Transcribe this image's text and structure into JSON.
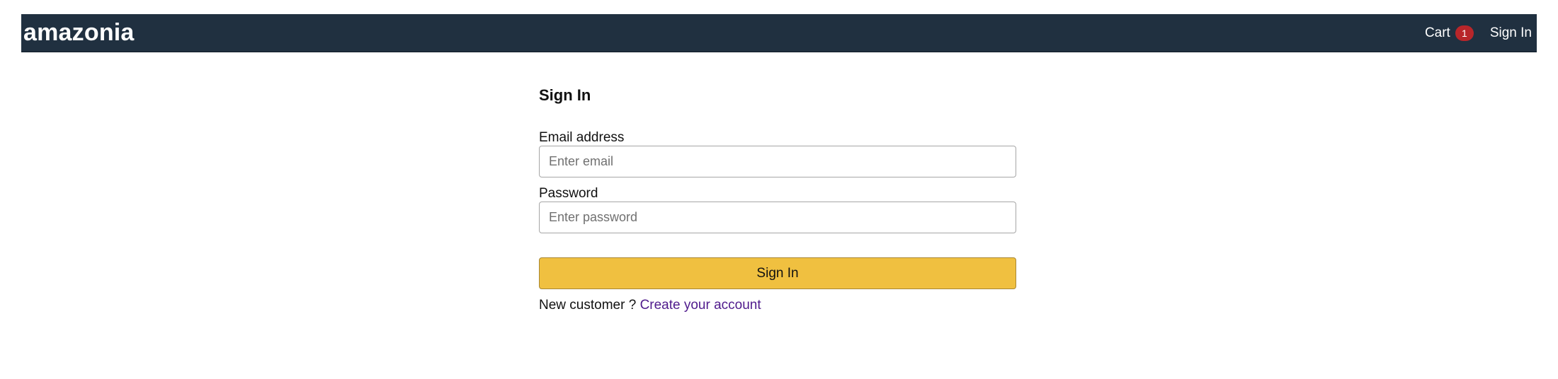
{
  "header": {
    "brand": "amazonia",
    "cart_label": "Cart",
    "cart_count": "1",
    "signin_label": "Sign In"
  },
  "signin_form": {
    "title": "Sign In",
    "email": {
      "label": "Email address",
      "value": "",
      "placeholder": "Enter email"
    },
    "password": {
      "label": "Password",
      "value": "",
      "placeholder": "Enter password"
    },
    "submit_label": "Sign In",
    "new_customer_text": "New customer ?",
    "create_account_label": "Create your account"
  },
  "colors": {
    "header_bg": "#203040",
    "button_bg": "#f0c040",
    "badge_bg": "#b8262a",
    "link": "#4f1a8c"
  }
}
